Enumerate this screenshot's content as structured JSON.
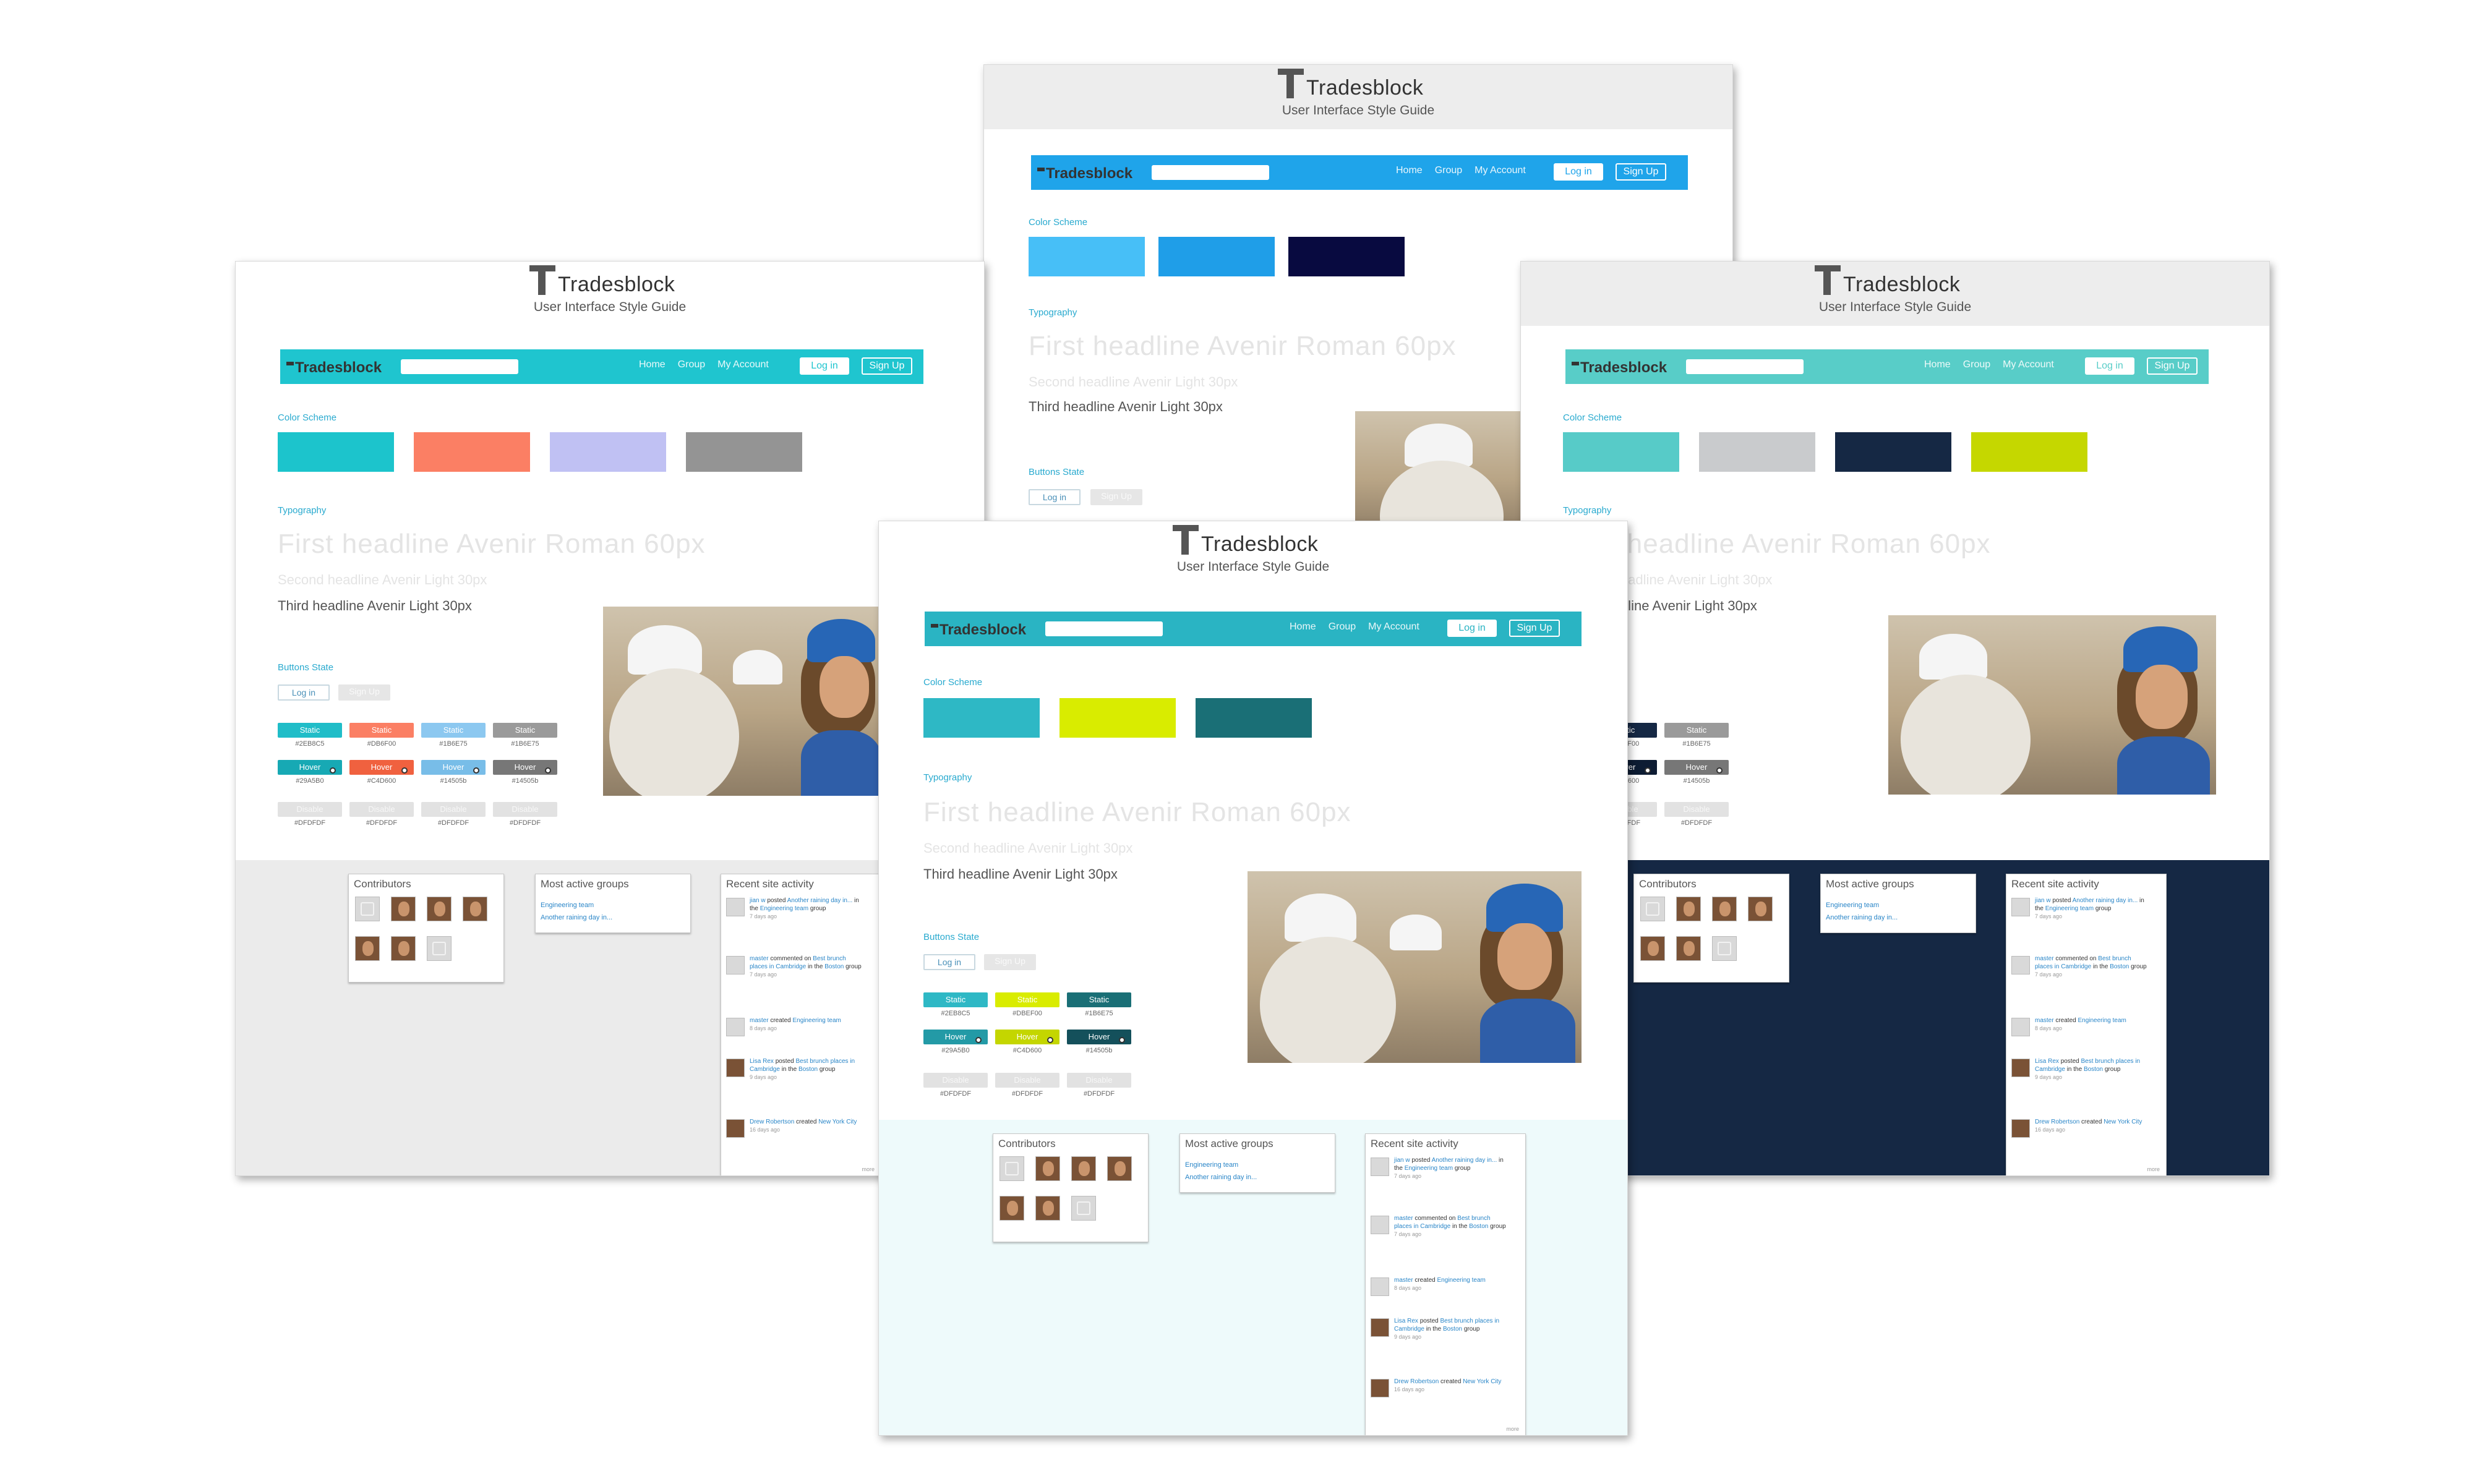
{
  "brand": {
    "name": "Tradesblock",
    "subtitle": "User Interface Style Guide"
  },
  "nav": {
    "home": "Home",
    "group": "Group",
    "account": "My Account",
    "login": "Log in",
    "signup": "Sign Up"
  },
  "sections": {
    "color_scheme": "Color Scheme",
    "typography": "Typography",
    "buttons_state": "Buttons State"
  },
  "typography": {
    "h1": "First headline Avenir Roman 60px",
    "h2": "Second headline Avenir Light 30px",
    "h3": "Third headline Avenir Light 30px"
  },
  "button_states": {
    "static": "Static",
    "hover": "Hover",
    "disable": "Disable"
  },
  "widgets": {
    "contributors": "Contributors",
    "groups": "Most active groups",
    "activity": "Recent site activity",
    "group_items": [
      "Engineering team",
      "Another raining day in..."
    ],
    "activities": [
      {
        "actor": "jian w",
        "verb": "posted",
        "obj": "Another raining day in...",
        "mid": "in the",
        "target": "Engineering team",
        "tail": "group",
        "ago": "7 days ago"
      },
      {
        "actor": "master",
        "verb": "commented on",
        "obj": "Best brunch places in Cambridge",
        "mid": "in the",
        "target": "Boston",
        "tail": "group",
        "ago": "7 days ago"
      },
      {
        "actor": "master",
        "verb": "created",
        "obj": "Engineering team",
        "mid": "",
        "target": "",
        "tail": "",
        "ago": "8 days ago"
      },
      {
        "actor": "Lisa Rex",
        "verb": "posted",
        "obj": "Best brunch places in Cambridge",
        "mid": "in the",
        "target": "Boston",
        "tail": "group",
        "ago": "9 days ago"
      },
      {
        "actor": "Drew Robertson",
        "verb": "created",
        "obj": "New York City",
        "mid": "",
        "target": "",
        "tail": "",
        "ago": "16 days ago"
      }
    ],
    "more": "more"
  },
  "variants": [
    {
      "id": "blue",
      "nav_color": "#1fa4ea",
      "footer_color": "#ffffff",
      "swatches": [
        "#47bff7",
        "#1f9ee8",
        "#080a40"
      ]
    },
    {
      "id": "teal-coral",
      "nav_color": "#1fc5cf",
      "footer_color": "#ebebeb",
      "swatches": [
        "#1cc4cc",
        "#fb7f64",
        "#c0c1f3",
        "#949494"
      ],
      "chips": {
        "static": [
          "#2EB8C5",
          "#DB6F00",
          "#1B6E75",
          "#1B6E75"
        ],
        "hover": [
          "#29A5B0",
          "#C4D600",
          "#14505b",
          "#14505b"
        ],
        "disable": [
          "#DFDFDF",
          "#DFDFDF",
          "#DFDFDF",
          "#DFDFDF"
        ]
      },
      "chip_colors": {
        "static": [
          "#20bdc8",
          "#fb7f64",
          "#8cc8f0",
          "#9a9a9a"
        ],
        "hover": [
          "#17a9b4",
          "#f0613f",
          "#78bde8",
          "#777777"
        ]
      }
    },
    {
      "id": "mint-navy",
      "nav_color": "#58cdc8",
      "footer_color": "#152844",
      "swatches": [
        "#57cbc8",
        "#c9cbcd",
        "#152844",
        "#c5d700"
      ],
      "chips": {
        "static": [
          "#DB6F00",
          "#1B6E75",
          "#1B6E75"
        ],
        "hover": [
          "#C4D600",
          "#14505b",
          "#14505b"
        ],
        "disable": [
          "#DFDFDF",
          "#DFDFDF",
          "#DFDFDF"
        ]
      },
      "chip_colors": {
        "static": [
          "#152844",
          "#152844",
          "#9a9a9a"
        ],
        "hover": [
          "#0d1c33",
          "#0d1c33",
          "#777777"
        ]
      }
    },
    {
      "id": "teal-lime",
      "nav_color": "#2ab4c3",
      "footer_color": "#eefafb",
      "swatches": [
        "#2eb8c5",
        "#d9ec00",
        "#1a6f76"
      ],
      "chips": {
        "static": [
          "#2EB8C5",
          "#DBEF00",
          "#1B6E75"
        ],
        "hover": [
          "#29A5B0",
          "#C4D600",
          "#14505b"
        ],
        "disable": [
          "#DFDFDF",
          "#DFDFDF",
          "#DFDFDF"
        ]
      },
      "chip_colors": {
        "static": [
          "#2eb8c5",
          "#d9ec00",
          "#1a6f76"
        ],
        "hover": [
          "#239aa6",
          "#c4d600",
          "#14505b"
        ]
      }
    }
  ]
}
